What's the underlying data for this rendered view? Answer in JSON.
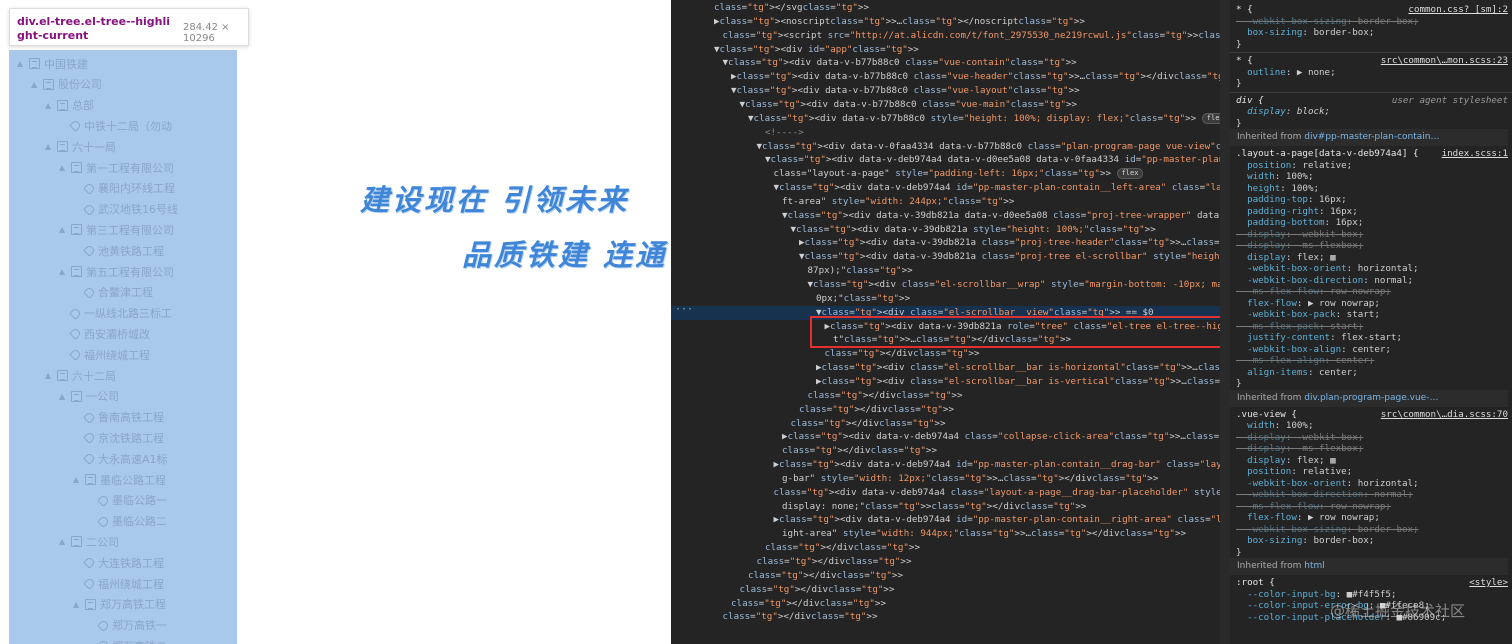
{
  "tooltip": {
    "selector": "div.el-tree.el-tree--highlight-current",
    "size": "284.42 × 10296"
  },
  "slogans": [
    "建设现在 引领未来",
    "品质铁建 连通"
  ],
  "tree": [
    {
      "label": "中国铁建",
      "level": 0,
      "type": "org",
      "arrow": "▲"
    },
    {
      "label": "股份公司",
      "level": 1,
      "type": "org",
      "arrow": "▲"
    },
    {
      "label": "总部",
      "level": 2,
      "type": "org",
      "arrow": "▲"
    },
    {
      "label": "中铁十二局（勿动",
      "level": 3,
      "type": "proj",
      "arrow": ""
    },
    {
      "label": "六十一局",
      "level": 2,
      "type": "org",
      "arrow": "▲"
    },
    {
      "label": "第一工程有限公司",
      "level": 3,
      "type": "org",
      "arrow": "▲"
    },
    {
      "label": "襄阳内环线工程",
      "level": 4,
      "type": "proj",
      "arrow": ""
    },
    {
      "label": "武汉地铁16号线",
      "level": 4,
      "type": "proj",
      "arrow": ""
    },
    {
      "label": "第三工程有限公司",
      "level": 3,
      "type": "org",
      "arrow": "▲"
    },
    {
      "label": "池黄铁路工程",
      "level": 4,
      "type": "proj",
      "arrow": ""
    },
    {
      "label": "第五工程有限公司",
      "level": 3,
      "type": "org",
      "arrow": "▲"
    },
    {
      "label": "合鳖津工程",
      "level": 4,
      "type": "proj",
      "arrow": ""
    },
    {
      "label": "一纵线北路三标工",
      "level": 3,
      "type": "proj",
      "arrow": ""
    },
    {
      "label": "西安灞桥城改",
      "level": 3,
      "type": "proj",
      "arrow": ""
    },
    {
      "label": "福州绕城工程",
      "level": 3,
      "type": "proj",
      "arrow": ""
    },
    {
      "label": "六十二局",
      "level": 2,
      "type": "org",
      "arrow": "▲"
    },
    {
      "label": "一公司",
      "level": 3,
      "type": "org",
      "arrow": "▲"
    },
    {
      "label": "鲁南高铁工程",
      "level": 4,
      "type": "proj",
      "arrow": ""
    },
    {
      "label": "京沈铁路工程",
      "level": 4,
      "type": "proj",
      "arrow": ""
    },
    {
      "label": "大永高速A1标",
      "level": 4,
      "type": "proj",
      "arrow": ""
    },
    {
      "label": "墨临公路工程",
      "level": 4,
      "type": "org",
      "arrow": "▲"
    },
    {
      "label": "墨临公路一",
      "level": 5,
      "type": "proj",
      "arrow": ""
    },
    {
      "label": "墨临公路二",
      "level": 5,
      "type": "proj",
      "arrow": ""
    },
    {
      "label": "二公司",
      "level": 3,
      "type": "org",
      "arrow": "▲"
    },
    {
      "label": "大连铁路工程",
      "level": 4,
      "type": "proj",
      "arrow": ""
    },
    {
      "label": "福州绕城工程",
      "level": 4,
      "type": "proj",
      "arrow": ""
    },
    {
      "label": "郑万高铁工程",
      "level": 4,
      "type": "org",
      "arrow": "▲"
    },
    {
      "label": "郑万高铁一",
      "level": 5,
      "type": "proj",
      "arrow": ""
    },
    {
      "label": "郑万高铁二",
      "level": 5,
      "type": "proj",
      "arrow": ""
    }
  ],
  "devtools_lines": [
    {
      "ind": 2,
      "html": "&lt;/svg&gt;",
      "kind": "tag"
    },
    {
      "ind": 2,
      "html": "▶&lt;noscript&gt;…&lt;/noscript&gt;",
      "kind": "tag"
    },
    {
      "ind": 3,
      "html": "&lt;script src=\"http://at.alicdn.com/t/font_2975530_ne219rcwul.js\"&gt;&lt;/script&gt;",
      "kind": "tag"
    },
    {
      "ind": 2,
      "html": "▼&lt;div id=\"app\"&gt;",
      "kind": "tag"
    },
    {
      "ind": 3,
      "html": "▼&lt;div data-v-b77b88c0 class=\"vue-contain\"&gt;",
      "kind": "tag"
    },
    {
      "ind": 4,
      "html": "▶&lt;div data-v-b77b88c0 class=\"vue-header\"&gt;…&lt;/div&gt;",
      "kind": "tag"
    },
    {
      "ind": 4,
      "html": "▼&lt;div data-v-b77b88c0 class=\"vue-layout\"&gt;",
      "kind": "tag"
    },
    {
      "ind": 5,
      "html": "▼&lt;div data-v-b77b88c0 class=\"vue-main\"&gt;",
      "kind": "tag"
    },
    {
      "ind": 6,
      "html": "▼&lt;div data-v-b77b88c0 style=\"height: 100%; display: flex;\"&gt;",
      "kind": "tag",
      "badge": "flex"
    },
    {
      "ind": 8,
      "html": "&lt;!----&gt;",
      "kind": "comment"
    },
    {
      "ind": 7,
      "html": "▼&lt;div data-v-0faa4334 data-v-b77b88c0 class=\"plan-program-page vue-view\"&gt;",
      "kind": "tag",
      "badge": "flex"
    },
    {
      "ind": 8,
      "html": "▼&lt;div data-v-deb974a4 data-v-d0ee5a08 data-v-0faa4334 id=\"pp-master-plan-contain\"",
      "kind": "tag"
    },
    {
      "ind": 9,
      "html": "class=\"layout-a-page\" style=\"padding-left: 16px;\"&gt;",
      "kind": "tag",
      "badge": "flex"
    },
    {
      "ind": 9,
      "html": "▼&lt;div data-v-deb974a4 id=\"pp-master-plan-contain__left-area\" class=\"layout-a-page__le",
      "kind": "tag"
    },
    {
      "ind": 10,
      "html": "ft-area\" style=\"width: 244px;\"&gt;",
      "kind": "tag"
    },
    {
      "ind": 10,
      "html": "▼&lt;div data-v-39db821a data-v-d0ee5a08 class=\"proj-tree-wrapper\" data-v-deb974a4&gt;",
      "kind": "tag"
    },
    {
      "ind": 11,
      "html": "▼&lt;div data-v-39db821a style=\"height: 100%;\"&gt;",
      "kind": "tag"
    },
    {
      "ind": 12,
      "html": "▶&lt;div data-v-39db821a class=\"proj-tree-header\"&gt;…&lt;/div&gt;",
      "kind": "tag"
    },
    {
      "ind": 12,
      "html": "▼&lt;div data-v-39db821a class=\"proj-tree el-scrollbar\" style=\"height: calc(100% -",
      "kind": "tag"
    },
    {
      "ind": 13,
      "html": "87px);\"&gt;",
      "kind": "tag"
    },
    {
      "ind": 13,
      "html": "▼&lt;div class=\"el-scrollbar__wrap\" style=\"margin-bottom: -10px; margin-right: -1",
      "kind": "tag"
    },
    {
      "ind": 14,
      "html": "0px;\"&gt;",
      "kind": "tag"
    },
    {
      "ind": 14,
      "html": "▼&lt;div class=\"el-scrollbar__view\"&gt; == $0",
      "kind": "tag",
      "hl": true
    },
    {
      "ind": 15,
      "html": "▶&lt;div data-v-39db821a role=\"tree\" class=\"el-tree el-tree--highlight-curren",
      "kind": "tag"
    },
    {
      "ind": 16,
      "html": "t\"&gt;…&lt;/div&gt;",
      "kind": "tag"
    },
    {
      "ind": 15,
      "html": "&lt;/div&gt;",
      "kind": "tag"
    },
    {
      "ind": 14,
      "html": "▶&lt;div class=\"el-scrollbar__bar is-horizontal\"&gt;…&lt;/div&gt;",
      "kind": "tag"
    },
    {
      "ind": 14,
      "html": "▶&lt;div class=\"el-scrollbar__bar is-vertical\"&gt;…&lt;/div&gt;",
      "kind": "tag"
    },
    {
      "ind": 13,
      "html": "&lt;/div&gt;",
      "kind": "tag"
    },
    {
      "ind": 12,
      "html": "&lt;/div&gt;",
      "kind": "tag"
    },
    {
      "ind": 11,
      "html": "&lt;/div&gt;",
      "kind": "tag"
    },
    {
      "ind": 10,
      "html": "▶&lt;div data-v-deb974a4 class=\"collapse-click-area\"&gt;…&lt;/div&gt;",
      "kind": "tag"
    },
    {
      "ind": 10,
      "html": "&lt;/div&gt;",
      "kind": "tag"
    },
    {
      "ind": 9,
      "html": "▶&lt;div data-v-deb974a4 id=\"pp-master-plan-contain__drag-bar\" class=\"layout-a-page__dra",
      "kind": "tag"
    },
    {
      "ind": 10,
      "html": "g-bar\" style=\"width: 12px;\"&gt;…&lt;/div&gt;",
      "kind": "tag"
    },
    {
      "ind": 9,
      "html": "&lt;div data-v-deb974a4 class=\"layout-a-page__drag-bar-placeholder\" style=\"width: 12px;",
      "kind": "tag"
    },
    {
      "ind": 10,
      "html": "display: none;\"&gt;&lt;/div&gt;",
      "kind": "tag"
    },
    {
      "ind": 9,
      "html": "▶&lt;div data-v-deb974a4 id=\"pp-master-plan-contain__right-area\" class=\"layout-a-page__r",
      "kind": "tag"
    },
    {
      "ind": 10,
      "html": "ight-area\" style=\"width: 944px;\"&gt;…&lt;/div&gt;",
      "kind": "tag"
    },
    {
      "ind": 8,
      "html": "&lt;/div&gt;",
      "kind": "tag"
    },
    {
      "ind": 7,
      "html": "&lt;/div&gt;",
      "kind": "tag"
    },
    {
      "ind": 6,
      "html": "&lt;/div&gt;",
      "kind": "tag"
    },
    {
      "ind": 5,
      "html": "&lt;/div&gt;",
      "kind": "tag"
    },
    {
      "ind": 4,
      "html": "&lt;/div&gt;",
      "kind": "tag"
    },
    {
      "ind": 3,
      "html": "&lt;/div&gt;",
      "kind": "tag"
    }
  ],
  "styles_lines": [
    {
      "t": "* {",
      "src": "common.css? [sm]:2"
    },
    {
      "t": "  -webkit-box-sizing: border-box;",
      "strike": true
    },
    {
      "t": "  box-sizing: border-box;"
    },
    {
      "t": "}"
    },
    {
      "sep": true
    },
    {
      "t": "* {",
      "src": "src\\common\\…mon.scss:23"
    },
    {
      "t": "  outline: ▶ none;"
    },
    {
      "t": "}"
    },
    {
      "sep": true
    },
    {
      "t": "div {",
      "src": "user agent stylesheet",
      "ua": true
    },
    {
      "t": "  display: block;",
      "ua": true
    },
    {
      "t": "}"
    },
    {
      "inh": "Inherited from ",
      "lnk": "div#pp-master-plan-contain…"
    },
    {
      "t": ".layout-a-page[data-v-deb974a4] {",
      "src": "index.scss:1"
    },
    {
      "t": "  position: relative;"
    },
    {
      "t": "  width: 100%;"
    },
    {
      "t": "  height: 100%;"
    },
    {
      "t": "  padding-top: 16px;"
    },
    {
      "t": "  padding-right: 16px;"
    },
    {
      "t": "  padding-bottom: 16px;"
    },
    {
      "t": "  display: -webkit-box;",
      "strike": true
    },
    {
      "t": "  display: -ms-flexbox;",
      "strike": true
    },
    {
      "t": "  display: flex; ▦"
    },
    {
      "t": "  -webkit-box-orient: horizontal;"
    },
    {
      "t": "  -webkit-box-direction: normal;"
    },
    {
      "t": "  -ms-flex-flow: row nowrap;",
      "strike": true
    },
    {
      "t": "  flex-flow: ▶ row nowrap;"
    },
    {
      "t": "  -webkit-box-pack: start;"
    },
    {
      "t": "  -ms-flex-pack: start;",
      "strike": true
    },
    {
      "t": "  justify-content: flex-start;"
    },
    {
      "t": "  -webkit-box-align: center;"
    },
    {
      "t": "  -ms-flex-align: center;",
      "strike": true
    },
    {
      "t": "  align-items: center;"
    },
    {
      "t": "}"
    },
    {
      "inh": "Inherited from ",
      "lnk": "div.plan-program-page.vue-…"
    },
    {
      "t": ".vue-view {",
      "src": "src\\common\\…dia.scss:70"
    },
    {
      "t": "  width: 100%;"
    },
    {
      "t": "  display: -webkit-box;",
      "strike": true
    },
    {
      "t": "  display: -ms-flexbox;",
      "strike": true
    },
    {
      "t": "  display: flex; ▦"
    },
    {
      "t": "  position: relative;"
    },
    {
      "t": "  -webkit-box-orient: horizontal;"
    },
    {
      "t": "  -webkit-box-direction: normal;",
      "strike": true
    },
    {
      "t": "  -ms-flex-flow: row nowrap;",
      "strike": true
    },
    {
      "t": "  flex-flow: ▶ row nowrap;"
    },
    {
      "t": "  -webkit-box-sizing: border-box;",
      "strike": true
    },
    {
      "t": "  box-sizing: border-box;"
    },
    {
      "t": "}"
    },
    {
      "inh": "Inherited from ",
      "lnk": "html"
    },
    {
      "t": ":root {",
      "src": "<style>"
    },
    {
      "t": "  --color-input-bg: ■#f4f5f5;"
    },
    {
      "t": "  --color-input-error-bg: ■#ffece8;"
    },
    {
      "t": "  --color-input-placeholder: ■#86909c;"
    }
  ],
  "watermark": "@稀土掘金技术社区"
}
